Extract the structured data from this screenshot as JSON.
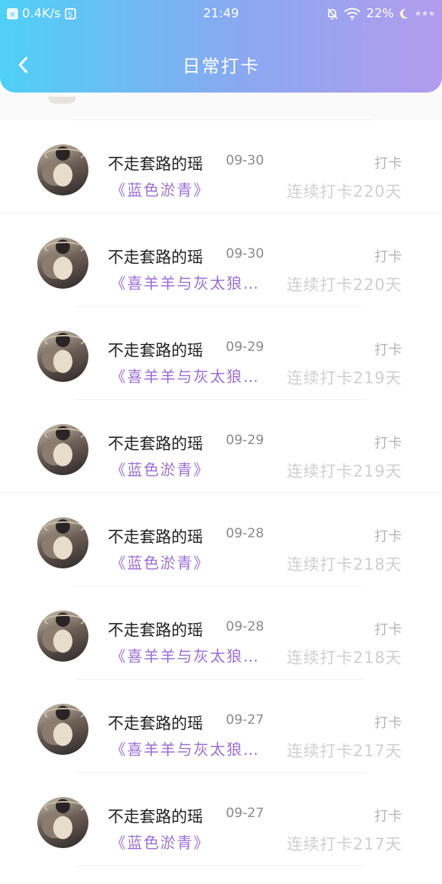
{
  "status_bar": {
    "speed": "0.4K/s",
    "time": "21:49",
    "battery": "22%"
  },
  "header": {
    "title": "日常打卡"
  },
  "checkins": [
    {
      "name": "不走套路的瑶",
      "date": "09-30",
      "tag": "打卡",
      "book": "《蓝色淤青》",
      "streak": "连续打卡220天"
    },
    {
      "name": "不走套路的瑶",
      "date": "09-30",
      "tag": "打卡",
      "book": "《喜羊羊与灰太狼…",
      "streak": "连续打卡220天"
    },
    {
      "name": "不走套路的瑶",
      "date": "09-29",
      "tag": "打卡",
      "book": "《喜羊羊与灰太狼…",
      "streak": "连续打卡219天"
    },
    {
      "name": "不走套路的瑶",
      "date": "09-29",
      "tag": "打卡",
      "book": "《蓝色淤青》",
      "streak": "连续打卡219天"
    },
    {
      "name": "不走套路的瑶",
      "date": "09-28",
      "tag": "打卡",
      "book": "《蓝色淤青》",
      "streak": "连续打卡218天"
    },
    {
      "name": "不走套路的瑶",
      "date": "09-28",
      "tag": "打卡",
      "book": "《喜羊羊与灰太狼…",
      "streak": "连续打卡218天"
    },
    {
      "name": "不走套路的瑶",
      "date": "09-27",
      "tag": "打卡",
      "book": "《喜羊羊与灰太狼…",
      "streak": "连续打卡217天"
    },
    {
      "name": "不走套路的瑶",
      "date": "09-27",
      "tag": "打卡",
      "book": "《蓝色淤青》",
      "streak": "连续打卡217天"
    }
  ]
}
